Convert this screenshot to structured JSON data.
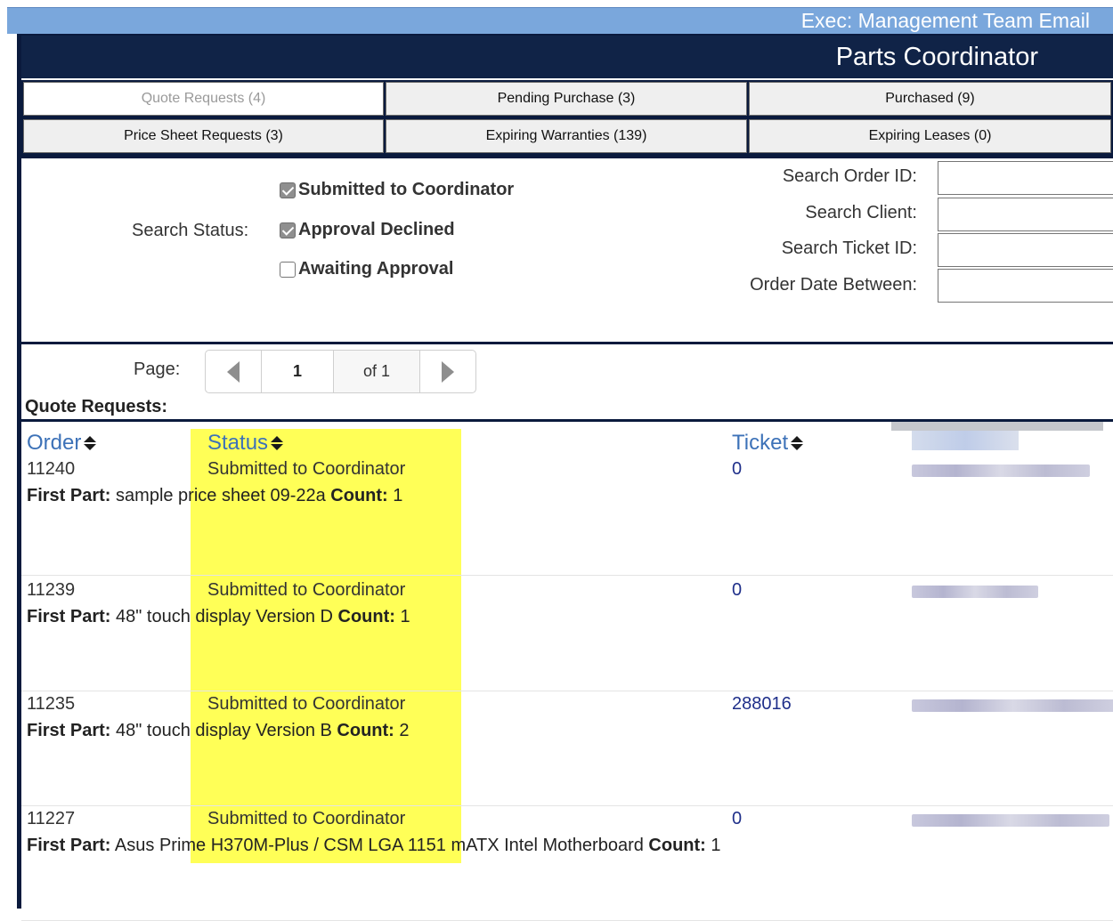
{
  "header": {
    "exec_link": "Exec: Management Team Email",
    "title": "Parts Coordinator"
  },
  "tabs": [
    {
      "label": "Quote Requests (4)",
      "active": true
    },
    {
      "label": "Pending Purchase (3)",
      "active": false
    },
    {
      "label": "Purchased (9)",
      "active": false
    },
    {
      "label": "Price Sheet Requests (3)",
      "active": false
    },
    {
      "label": "Expiring Warranties (139)",
      "active": false
    },
    {
      "label": "Expiring Leases (0)",
      "active": false
    }
  ],
  "search": {
    "status_label": "Search Status:",
    "statuses": [
      {
        "label": "Submitted to Coordinator",
        "checked": true
      },
      {
        "label": "Approval Declined",
        "checked": true
      },
      {
        "label": "Awaiting Approval",
        "checked": false
      }
    ],
    "fields": [
      {
        "label": "Search Order ID:",
        "value": ""
      },
      {
        "label": "Search Client:",
        "value": ""
      },
      {
        "label": "Search Ticket ID:",
        "value": ""
      },
      {
        "label": "Order Date Between:",
        "value": ""
      }
    ]
  },
  "pager": {
    "page_label": "Page:",
    "current": "1",
    "of": "of 1"
  },
  "list": {
    "title": "Quote Requests:",
    "headers": {
      "order": "Order",
      "status": "Status",
      "ticket": "Ticket"
    },
    "first_part_label": "First Part:",
    "count_label": "Count:",
    "rows": [
      {
        "order": "11240",
        "status": "Submitted to Coordinator",
        "ticket": "0",
        "part": "sample price sheet 09-22a",
        "count": "1"
      },
      {
        "order": "11239",
        "status": "Submitted to Coordinator",
        "ticket": "0",
        "part": "48\" touch display Version D",
        "count": "1"
      },
      {
        "order": "11235",
        "status": "Submitted to Coordinator",
        "ticket": "288016",
        "part": "48\" touch display Version B",
        "count": "2"
      },
      {
        "order": "11227",
        "status": "Submitted to Coordinator",
        "ticket": "0",
        "part": "Asus Prime H370M-Plus / CSM LGA 1151 mATX Intel Motherboard",
        "count": "1"
      }
    ]
  },
  "colors": {
    "navy": "#102347",
    "top_strip": "#7aa7dc",
    "highlight": "#ffff57",
    "link": "#3d72b8"
  }
}
